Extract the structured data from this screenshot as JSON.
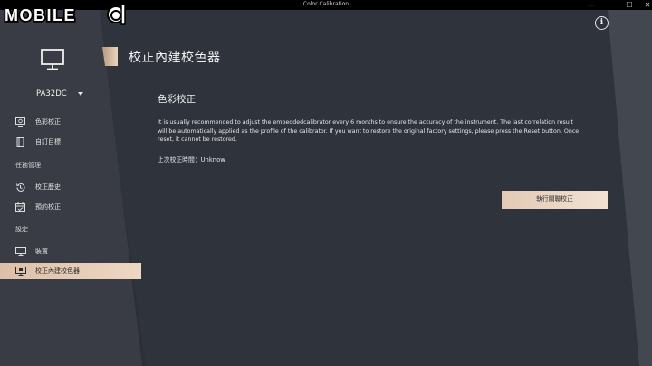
{
  "window": {
    "title": "Color Calibration",
    "controls": {
      "minimize": "—",
      "maximize": "☐",
      "close": "✕"
    }
  },
  "watermark": {
    "text": "MOBILE"
  },
  "sidebar": {
    "monitor_icon": "monitor-icon",
    "model": "PA32DC",
    "items": [
      {
        "label": "色彩校正",
        "icon": "color-calibration-icon"
      },
      {
        "label": "自訂目標",
        "icon": "custom-target-icon"
      }
    ],
    "task_section": "任務管理",
    "task_items": [
      {
        "label": "校正歷史",
        "icon": "history-icon"
      },
      {
        "label": "預約校正",
        "icon": "calendar-icon"
      }
    ],
    "settings_section": "設定",
    "settings_items": [
      {
        "label": "裝置",
        "icon": "device-icon"
      },
      {
        "label": "校正內建校色器",
        "icon": "calibrator-icon",
        "active": true
      }
    ]
  },
  "main": {
    "title": "校正內建校色器",
    "info_label": "i",
    "section_title": "色彩校正",
    "description": "It is usually recommended to adjust the embeddedcalibrator every 6 months to ensure the accuracy of the instrument. The last correlation result will be automatically applied as the profile of the calibrator. If you want to restore the original factory settings, please press the Reset button. Once reset, it cannot be restored.",
    "last_calibration": "上次校正時間：Unknow",
    "run_button": "執行關聯校正"
  },
  "colors": {
    "accent": "#e8d2bd",
    "sidebar_bg": "#393c44",
    "panel_bg": "#2f333c"
  }
}
